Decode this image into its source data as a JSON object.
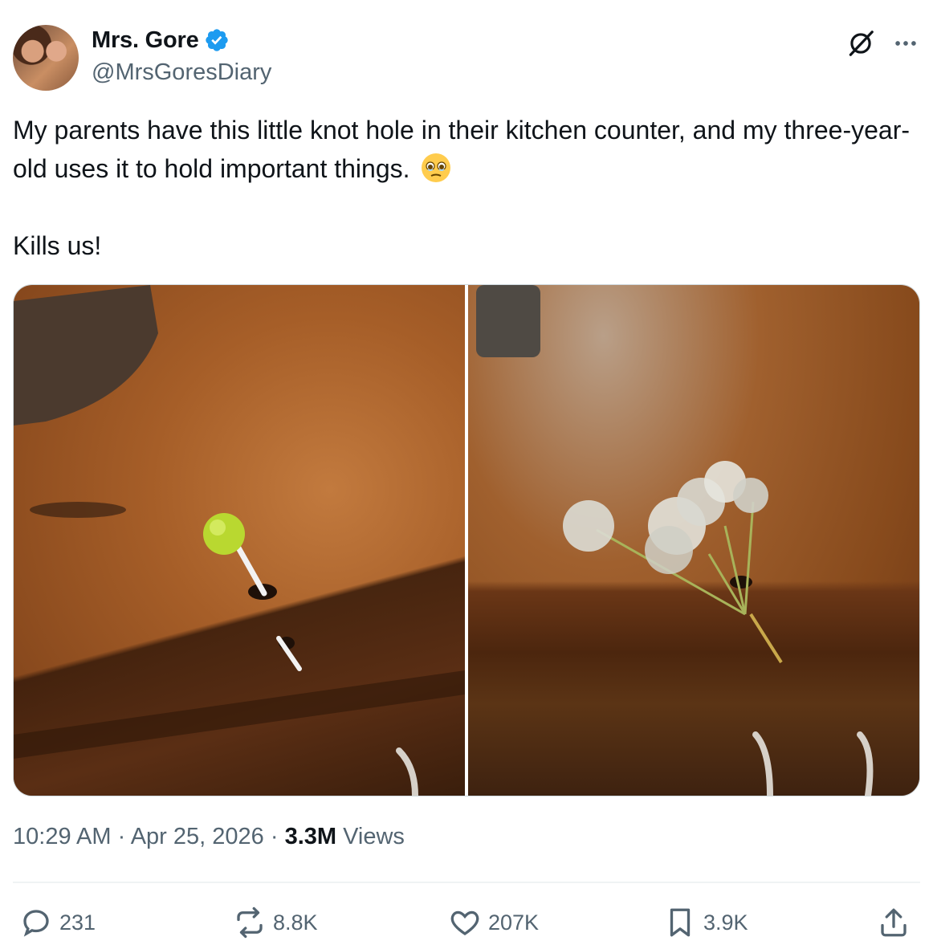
{
  "author": {
    "display_name": "Mrs. Gore",
    "handle": "@MrsGoresDiary",
    "verified": true,
    "verified_color": "#1d9bf0"
  },
  "header_icons": {
    "grok": "grok-slash-circle-icon",
    "more": "more-dots-icon"
  },
  "tweet": {
    "line1": "My parents have this little knot hole in their kitchen counter, and my three-year-old uses it to hold important things.",
    "emoji": "face-holding-back-tears-emoji",
    "line2": "Kills us!"
  },
  "media": [
    {
      "kind": "photo",
      "subject": "lollipop-in-counter-knot-hole"
    },
    {
      "kind": "photo",
      "subject": "dandelions-in-counter-knot-hole"
    }
  ],
  "meta": {
    "time": "10:29 AM",
    "sep1": " · ",
    "date": "Apr 25, 2026",
    "sep2": " · ",
    "views": "3.3M",
    "views_label": " Views"
  },
  "actions": {
    "replies": "231",
    "reposts": "8.8K",
    "likes": "207K",
    "bookmarks": "3.9K"
  },
  "colors": {
    "text": "#0f1419",
    "secondary": "#536471",
    "border": "#cfd9de"
  }
}
